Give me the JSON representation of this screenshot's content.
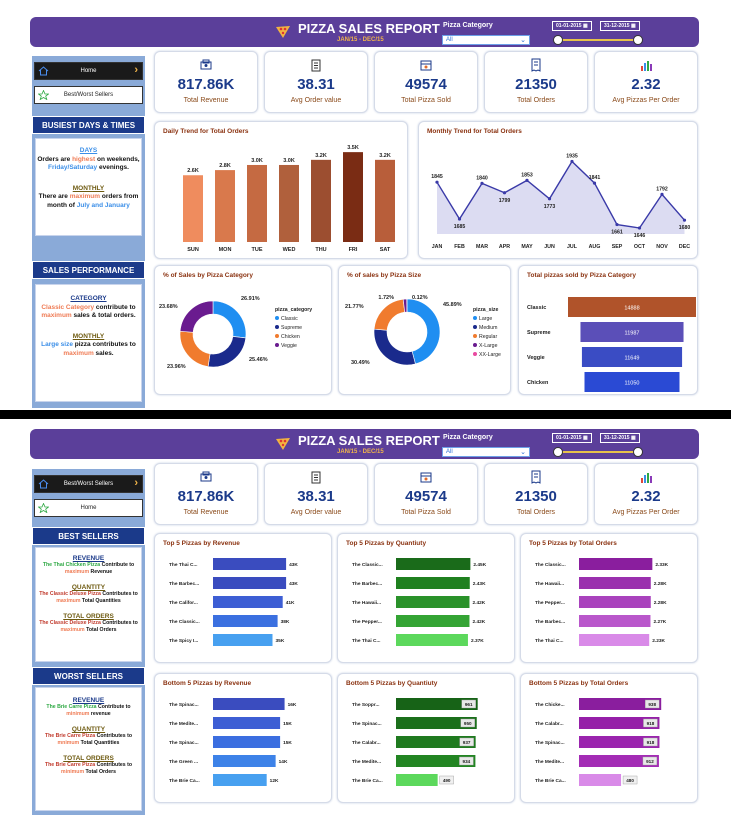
{
  "report": {
    "title": "PIZZA SALES REPORT",
    "date_range": "JAN/15 - DEC/15",
    "filter_label": "Pizza Category",
    "filter_value": "All",
    "date_start": "01-01-2015",
    "date_end": "31-12-2015"
  },
  "kpis": [
    {
      "value": "817.86K",
      "label": "Total Revenue",
      "icon": "money-icon"
    },
    {
      "value": "38.31",
      "label": "Avg Order value",
      "icon": "clipboard-icon"
    },
    {
      "value": "49574",
      "label": "Total Pizza Sold",
      "icon": "pizza-box-icon"
    },
    {
      "value": "21350",
      "label": "Total Orders",
      "icon": "receipt-icon"
    },
    {
      "value": "2.32",
      "label": "Avg Pizzas Per Order",
      "icon": "bar-chart-icon"
    }
  ],
  "page1": {
    "nav": {
      "home": "Home",
      "best_worst": "Best/Worst Sellers"
    },
    "busiest_title": "BUSIEST DAYS & TIMES",
    "days": {
      "heading": "DAYS",
      "t1": "Orders are ",
      "hl1": "highest",
      "t2": " on weekends, ",
      "hl2": "Friday/Saturday",
      "t3": " evenings."
    },
    "monthly": {
      "heading": "MONTHLY",
      "t1": "There are ",
      "hl1": "maximum",
      "t2": " orders from month of ",
      "hl2": "July and January"
    },
    "perf_title": "SALES PERFORMANCE",
    "category": {
      "heading": "CATEGORY",
      "hl1": "Classic Category",
      "t1": " contribute to ",
      "hl2": "maximum",
      "t2": " sales & total orders."
    },
    "monthly2": {
      "heading": "MONTHLY",
      "hl1": "Large size",
      "t1": " pizza contributes to ",
      "hl2": "maximum",
      "t2": " sales."
    }
  },
  "page2": {
    "nav": {
      "best_worst": "Best/Worst Sellers",
      "home": "Home"
    },
    "best_title": "BEST SELLERS",
    "best": [
      {
        "heading": "REVENUE",
        "hl": "The Thai Chicken Pizza",
        "t": " Contribute to ",
        "hl2": "maximum",
        "t2": " Revenue"
      },
      {
        "heading": "QUANTITY",
        "hl": "The Classic Deluxe Pizza",
        "t": " Contributes to ",
        "hl2": "maximum",
        "t2": " Total Quantities"
      },
      {
        "heading": "TOTAL ORDERS",
        "hl": "The Classic Deluxe Pizza",
        "t": " Contributes to ",
        "hl2": "maximum",
        "t2": " Total Orders"
      }
    ],
    "worst_title": "WORST SELLERS",
    "worst": [
      {
        "heading": "REVENUE",
        "hl": "The Brie Carre Pizza",
        "t": " Contribute to ",
        "hl2": "minimum",
        "t2": " revenue"
      },
      {
        "heading": "QUANTITY",
        "hl": "The Brie Carre Pizza",
        "t": " Contributes to ",
        "hl2": "mnimum",
        "t2": " Total Quantities"
      },
      {
        "heading": "TOTAL ORDERS",
        "hl": "The Brie Carre Pizza",
        "t": " Contributes to ",
        "hl2": "minimum",
        "t2": " Total Orders"
      }
    ]
  },
  "chart_data": [
    {
      "id": "daily",
      "type": "bar",
      "title": "Daily Trend for Total Orders",
      "categories": [
        "SUN",
        "MON",
        "TUE",
        "WED",
        "THU",
        "FRI",
        "SAT"
      ],
      "values": [
        2.6,
        2.8,
        3.0,
        3.0,
        3.2,
        3.5,
        3.2
      ],
      "labels": [
        "2.6K",
        "2.8K",
        "3.0K",
        "3.0K",
        "3.2K",
        "3.5K",
        "3.2K"
      ],
      "colors": [
        "#ef8c5e",
        "#d9794c",
        "#c56a42",
        "#b0603c",
        "#9c4e30",
        "#7a2c14",
        "#b85e3a"
      ]
    },
    {
      "id": "monthly",
      "type": "area",
      "title": "Monthly Trend for Total Orders",
      "categories": [
        "JAN",
        "FEB",
        "MAR",
        "APR",
        "MAY",
        "JUN",
        "JUL",
        "AUG",
        "SEP",
        "OCT",
        "NOV",
        "DEC"
      ],
      "values": [
        1845,
        1685,
        1840,
        1799,
        1853,
        1773,
        1935,
        1841,
        1661,
        1646,
        1792,
        1680
      ]
    },
    {
      "id": "sales_category",
      "type": "pie",
      "title": "% of Sales by Pizza Category",
      "legend_title": "pizza_category",
      "slices": [
        {
          "name": "Classic",
          "value": 26.91,
          "label": "26.91%",
          "color": "#1f8ef1"
        },
        {
          "name": "Supreme",
          "value": 25.46,
          "label": "25.46%",
          "color": "#1a2a8c"
        },
        {
          "name": "Chicken",
          "value": 23.96,
          "label": "23.96%",
          "color": "#f07b2e"
        },
        {
          "name": "Veggie",
          "value": 23.68,
          "label": "23.68%",
          "color": "#6a1b8f"
        }
      ]
    },
    {
      "id": "sales_size",
      "type": "pie",
      "title": "% of sales by Pizza Size",
      "legend_title": "pizza_size",
      "slices": [
        {
          "name": "Large",
          "value": 45.89,
          "label": "45.89%",
          "color": "#1f8ef1"
        },
        {
          "name": "Medium",
          "value": 30.49,
          "label": "30.49%",
          "color": "#1a2a8c"
        },
        {
          "name": "Regular",
          "value": 21.77,
          "label": "21.77%",
          "color": "#f07b2e"
        },
        {
          "name": "X-Large",
          "value": 1.72,
          "label": "1.72%",
          "color": "#6a1b8f"
        },
        {
          "name": "XX-Large",
          "value": 0.12,
          "label": "0.12%",
          "color": "#e94aa0"
        }
      ]
    },
    {
      "id": "sold_category",
      "type": "bar",
      "title": "Total pizzas sold by Pizza Category",
      "categories": [
        "Classic",
        "Supreme",
        "Veggie",
        "Chicken"
      ],
      "values": [
        14888,
        11987,
        11649,
        11050
      ],
      "colors": [
        "#b0532a",
        "#5b4fb8",
        "#3a4cc4",
        "#2a4ad4"
      ]
    },
    {
      "id": "top_revenue",
      "type": "bar",
      "title": "Top 5 Pizzas by Revenue",
      "categories": [
        "The Thai C...",
        "The Barbec...",
        "The Califor...",
        "The Classic...",
        "The Spicy I..."
      ],
      "values": [
        43,
        43,
        41,
        38,
        35
      ],
      "labels": [
        "43K",
        "43K",
        "41K",
        "38K",
        "35K"
      ],
      "colors": [
        "#3a4cbf",
        "#3a4cbf",
        "#3d5ed4",
        "#3b70e0",
        "#47a0f0"
      ],
      "max": 50
    },
    {
      "id": "top_quantity",
      "type": "bar",
      "title": "Top 5 Pizzas by Quantiuty",
      "categories": [
        "The Classic...",
        "The Barbec...",
        "The Hawaii...",
        "The Pepper...",
        "The Thai C..."
      ],
      "values": [
        2.45,
        2.43,
        2.42,
        2.42,
        2.37
      ],
      "labels": [
        "2.45K",
        "2.43K",
        "2.42K",
        "2.42K",
        "2.37K"
      ],
      "colors": [
        "#1a6b1a",
        "#1f801f",
        "#2a922a",
        "#34a434",
        "#5cd85c"
      ],
      "max": 2.8
    },
    {
      "id": "top_orders",
      "type": "bar",
      "title": "Top 5 Pizzas by Total Orders",
      "categories": [
        "The Classic...",
        "The Hawaii...",
        "The Pepper...",
        "The Barbec...",
        "The Thai C..."
      ],
      "values": [
        2.33,
        2.28,
        2.28,
        2.27,
        2.23
      ],
      "labels": [
        "2.33K",
        "2.28K",
        "2.28K",
        "2.27K",
        "2.23K"
      ],
      "colors": [
        "#8a1e9e",
        "#9a30ae",
        "#a942bd",
        "#b957cb",
        "#d98ae8"
      ],
      "max": 2.7
    },
    {
      "id": "bottom_revenue",
      "type": "bar",
      "title": "Bottom 5 Pizzas by Revenue",
      "categories": [
        "The Spinac...",
        "The Medite...",
        "The Spinac...",
        "The Green ...",
        "The Brie Ca..."
      ],
      "values": [
        16,
        15,
        15,
        14,
        12
      ],
      "labels": [
        "16K",
        "15K",
        "15K",
        "14K",
        "12K"
      ],
      "colors": [
        "#3a4cbf",
        "#3d5ed4",
        "#3b6ee0",
        "#3d82e8",
        "#47a0f0"
      ],
      "max": 19
    },
    {
      "id": "bottom_quantity",
      "type": "bar",
      "title": "Bottom 5 Pizzas by Quantiuty",
      "categories": [
        "The Soppr...",
        "The Spinac...",
        "The Calabr...",
        "The Medite...",
        "The Brie Ca..."
      ],
      "values": [
        961,
        950,
        937,
        934,
        490
      ],
      "labels": [
        "961",
        "950",
        "937",
        "934",
        "490"
      ],
      "colors": [
        "#176317",
        "#1b6f1b",
        "#1f7a1f",
        "#228522",
        "#5cd85c"
      ],
      "max": 1000,
      "label_inside": true
    },
    {
      "id": "bottom_orders",
      "type": "bar",
      "title": "Bottom 5 Pizzas by Total Orders",
      "categories": [
        "The Chicke...",
        "The Calabr...",
        "The Spinac...",
        "The Medite...",
        "The Brie Ca..."
      ],
      "values": [
        938,
        918,
        918,
        912,
        480
      ],
      "labels": [
        "938",
        "918",
        "918",
        "912",
        "480"
      ],
      "colors": [
        "#8a1e9e",
        "#951fa8",
        "#9a24ae",
        "#a32cb5",
        "#d98ae8"
      ],
      "max": 970,
      "label_inside": true
    }
  ]
}
